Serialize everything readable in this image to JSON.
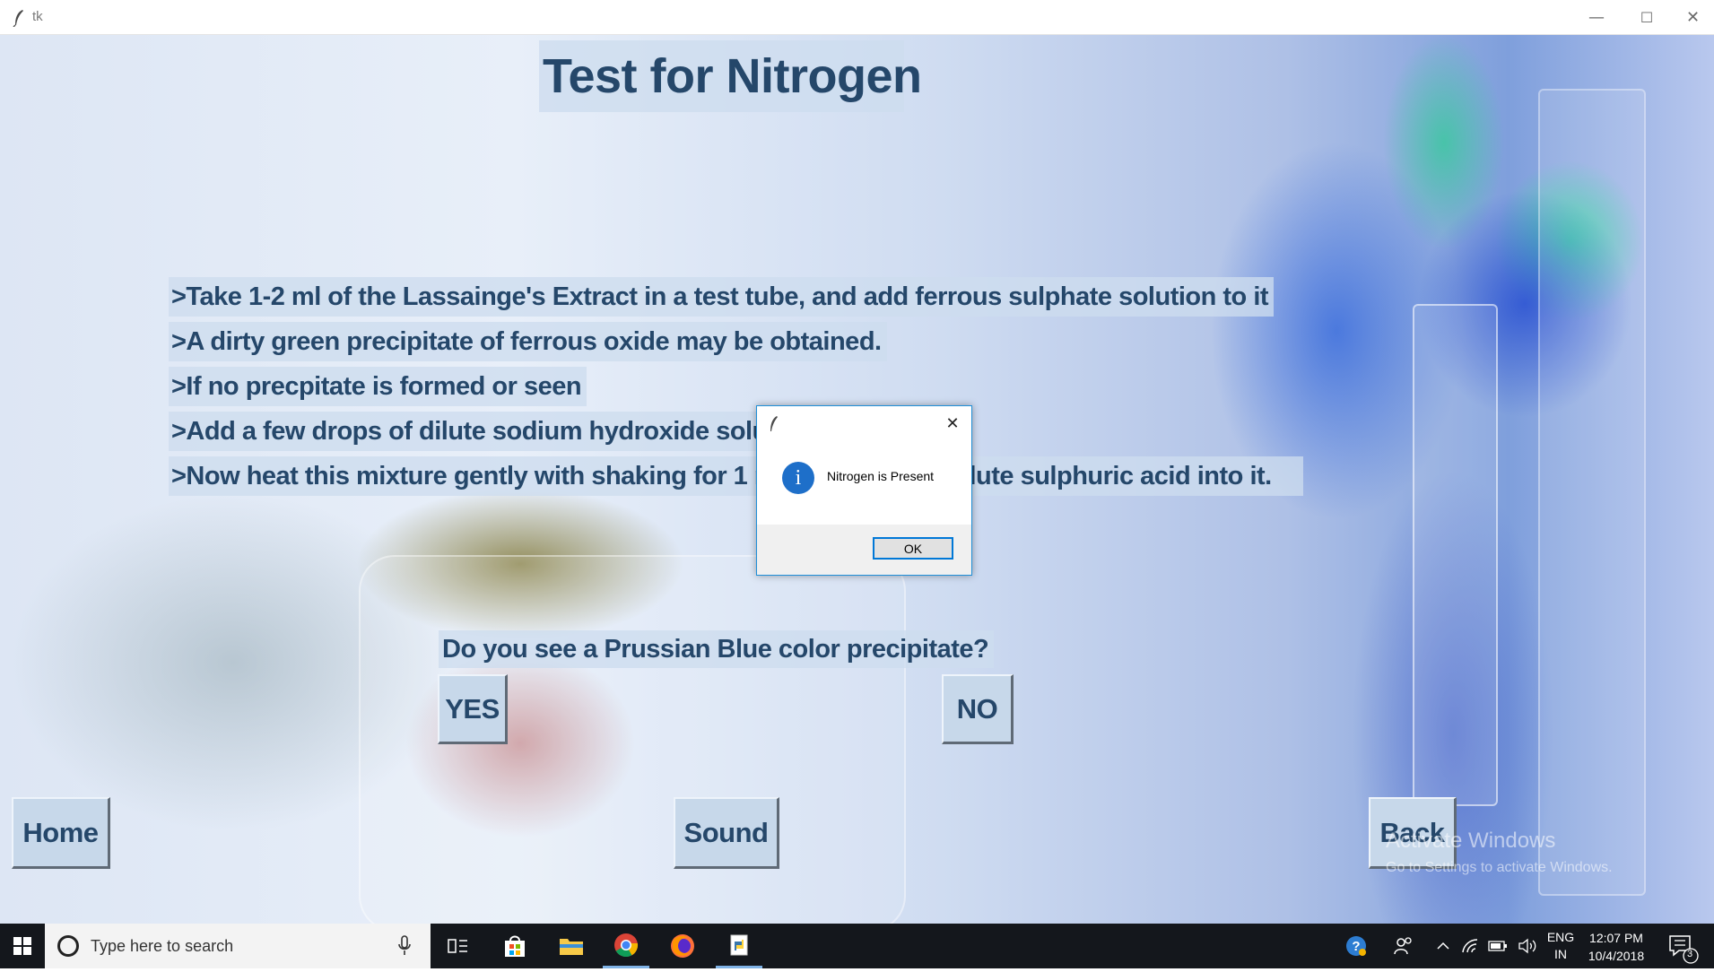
{
  "window": {
    "title": "tk",
    "controls": {
      "minimize": "—",
      "maximize": "☐",
      "close": "✕"
    }
  },
  "page": {
    "title": "Test for Nitrogen",
    "steps": [
      ">Take 1-2 ml of the Lassainge's Extract in a test tube, and add ferrous sulphate solution to it",
      ">A dirty green precipitate of ferrous oxide may be obtained.",
      ">If no precpitate is formed or seen",
      ">Add a few drops of dilute sodium hydroxide solution to obtain it.",
      ">Now heat this mixture gently with shaking for 1 minute and add dilute sulphuric acid into it."
    ],
    "question": "Do you see a Prussian Blue color precipitate?",
    "buttons": {
      "yes": "YES",
      "no": "NO",
      "home": "Home",
      "sound": "Sound",
      "back": "Back"
    },
    "watermark": {
      "line1": "Activate Windows",
      "line2": "Go to Settings to activate Windows."
    }
  },
  "dialog": {
    "close": "✕",
    "info_icon": "i",
    "message": "Nitrogen is Present",
    "ok_label": "OK"
  },
  "taskbar": {
    "search_placeholder": "Type here to search",
    "apps": [
      "task-view-icon",
      "store-icon",
      "file-explorer-icon",
      "chrome-icon",
      "firefox-icon",
      "python-idle-icon"
    ],
    "language": {
      "line1": "ENG",
      "line2": "IN"
    },
    "clock": {
      "time": "12:07 PM",
      "date": "10/4/2018"
    },
    "notification_count": "3",
    "colors": {
      "taskbar_bg": "#14171c",
      "accent": "#0078d7",
      "text_strip": "#25476a"
    }
  }
}
